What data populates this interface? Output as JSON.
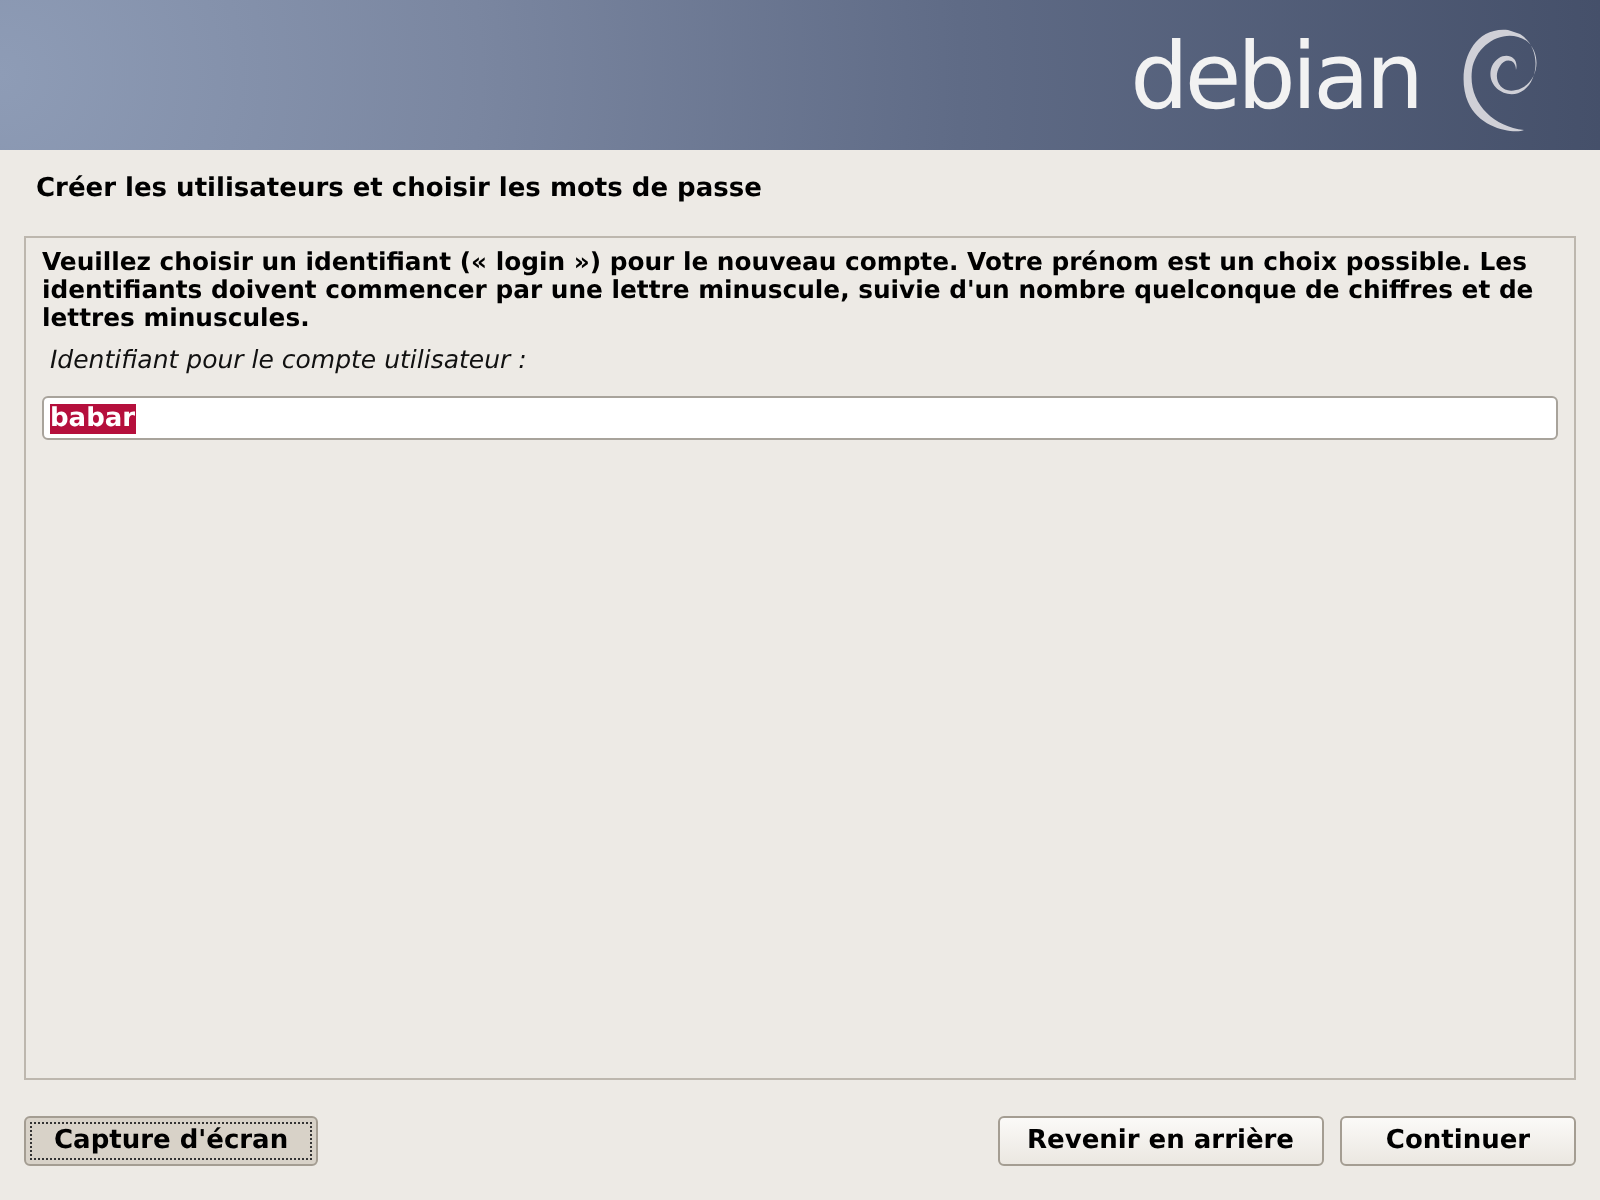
{
  "banner": {
    "logo_text": "debian"
  },
  "page_title": "Créer les utilisateurs et choisir les mots de passe",
  "description": "Veuillez choisir un identifiant (« login ») pour le nouveau compte. Votre prénom est un choix possible. Les identifiants doivent commencer par une lettre minuscule, suivie d'un nombre quelconque de chiffres et de lettres minuscules.",
  "field": {
    "label": "Identifiant pour le compte utilisateur :",
    "value": "babar",
    "text_selected": true
  },
  "left_buttons": [
    {
      "label": "Capture d'écran",
      "focused": true
    }
  ],
  "right_buttons": [
    {
      "label": "Revenir en arrière",
      "focused": false
    },
    {
      "label": "Continuer",
      "focused": false
    }
  ]
}
